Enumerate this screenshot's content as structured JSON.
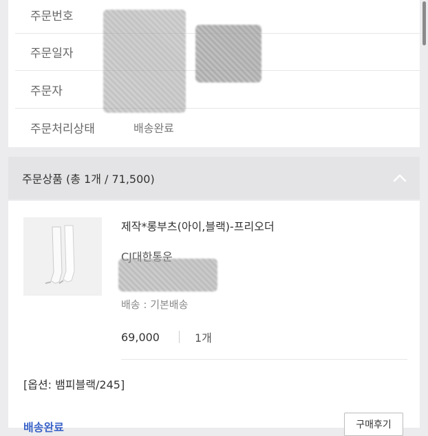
{
  "order_info": {
    "rows": [
      {
        "label": "주문번호",
        "value": ""
      },
      {
        "label": "주문일자",
        "value": ""
      },
      {
        "label": "주문자",
        "value": ""
      },
      {
        "label": "주문처리상태",
        "value": "배송완료"
      }
    ]
  },
  "products_section": {
    "title": "주문상품 (총 1개 / 71,500)"
  },
  "product": {
    "name": "제작*롱부츠(아이,블랙)-프리오더",
    "courier": "CJ대한통운",
    "shipping": "배송 : 기본배송",
    "price": "69,000",
    "quantity": "1개",
    "option": "[옵션: 뱀피블랙/245]"
  },
  "footer": {
    "status": "배송완료",
    "review_button": "구매후기"
  },
  "colors": {
    "link_blue": "#3a63c9",
    "header_bg": "#e4e4e6"
  }
}
